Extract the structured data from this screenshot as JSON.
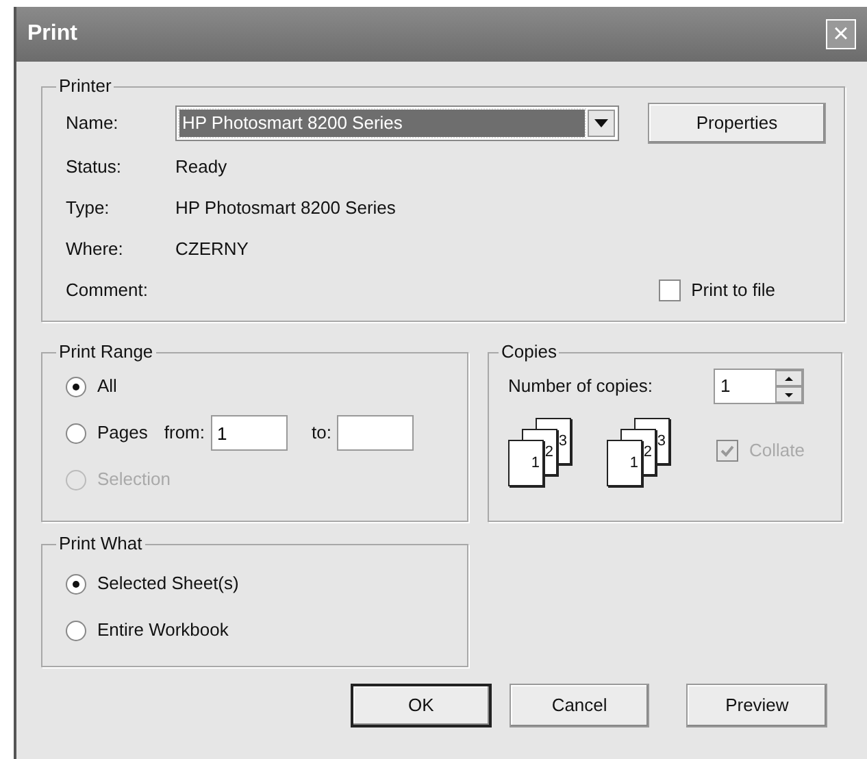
{
  "window": {
    "title": "Print",
    "close": "×"
  },
  "printer": {
    "group_label": "Printer",
    "name_label": "Name:",
    "name_value": "HP Photosmart 8200 Series",
    "properties_button": "Properties",
    "info": [
      {
        "label": "Status:",
        "value": "Ready"
      },
      {
        "label": "Type:",
        "value": "HP Photosmart 8200 Series"
      },
      {
        "label": "Where:",
        "value": "CZERNY"
      },
      {
        "label": "Comment:"
      }
    ],
    "print_to_file": {
      "label": "Print to file",
      "checked": false
    }
  },
  "print_range": {
    "group_label": "Print Range",
    "options": [
      {
        "label": "All",
        "selected": true,
        "disabled": false
      },
      {
        "label": "Pages",
        "selected": false,
        "disabled": false,
        "from_label": "from:",
        "from_value": "1",
        "to_label": "to:"
      },
      {
        "label": "Selection",
        "selected": false,
        "disabled": true
      }
    ]
  },
  "copies": {
    "group_label": "Copies",
    "number_label": "Number of copies:",
    "number_value": "1",
    "stacks": [
      [
        "1",
        "2",
        "3"
      ],
      [
        "1",
        "2",
        "3"
      ]
    ],
    "collate": {
      "label": "Collate",
      "checked": true,
      "disabled": true
    }
  },
  "print_what": {
    "group_label": "Print What",
    "options": [
      {
        "label": "Selected Sheet(s)",
        "selected": true,
        "disabled": false
      },
      {
        "label": "Entire Workbook",
        "selected": false,
        "disabled": false
      }
    ]
  },
  "buttons": [
    {
      "label": "OK",
      "default": true
    },
    {
      "label": "Cancel",
      "default": false
    },
    {
      "label": "Preview",
      "default": false
    }
  ]
}
